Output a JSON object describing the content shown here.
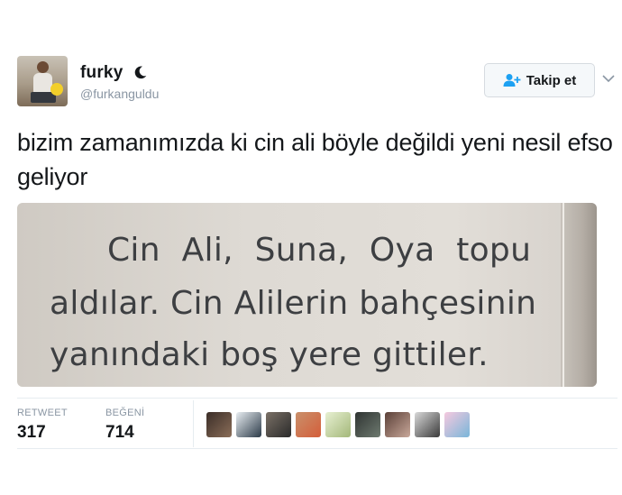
{
  "author": {
    "display_name": "furky",
    "handle": "@furkanguldu",
    "name_emoji": "moon-icon",
    "avatar_icon": "user-avatar"
  },
  "follow_button": {
    "label": "Takip et",
    "icon": "add-user-icon"
  },
  "tweet": {
    "text": "bizim zamanımızda ki cin ali böyle değildi yeni nesil efso geliyor"
  },
  "photo": {
    "lines": [
      "Cin Ali, Suna, Oya topu",
      "aldılar. Cin Alilerin bahçesinin",
      "yanındaki boş yere gittiler."
    ]
  },
  "stats": {
    "retweet_label": "RETWEET",
    "retweet_count": "317",
    "like_label": "BEĞENİ",
    "like_count": "714"
  },
  "likers": [
    {
      "colors": [
        "#3b2e28",
        "#8a6d58"
      ]
    },
    {
      "colors": [
        "#e9eef2",
        "#2b3a48"
      ]
    },
    {
      "colors": [
        "#7a7066",
        "#2a2a2a"
      ]
    },
    {
      "colors": [
        "#c9906b",
        "#d45e3a"
      ]
    },
    {
      "colors": [
        "#e7f0d2",
        "#a4b87a"
      ]
    },
    {
      "colors": [
        "#2f3432",
        "#6e7a70"
      ]
    },
    {
      "colors": [
        "#5a4038",
        "#c9a89a"
      ]
    },
    {
      "colors": [
        "#d9d9d9",
        "#3a3a3a"
      ]
    },
    {
      "colors": [
        "#f6c9df",
        "#79b6d9"
      ]
    }
  ],
  "colors": {
    "text": "#14171a",
    "muted": "#8a96a3",
    "accent": "#1da1f2",
    "border": "#e6ecf0"
  }
}
